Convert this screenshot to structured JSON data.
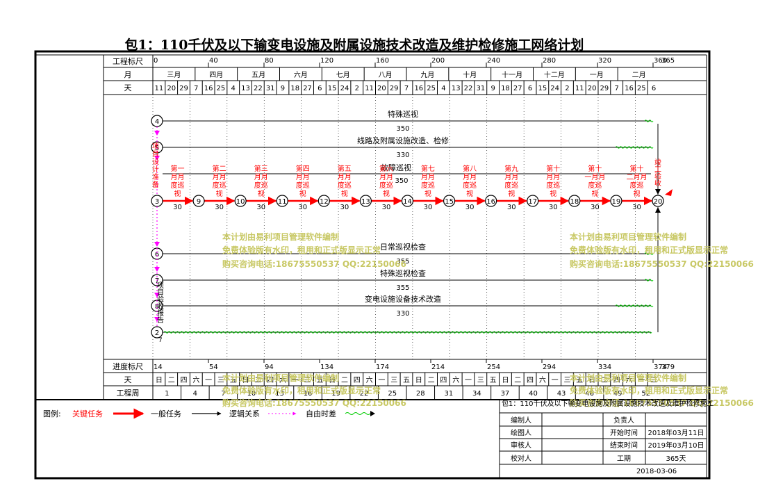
{
  "title": "包1：110千伏及以下输变电设施及附属设施技术改造及维护检修施工网络计划",
  "header_rows": {
    "scale_label": "工程标尺",
    "month_label": "月",
    "day_label": "天",
    "progress_label": "进度标尺",
    "weekday_row_label": "天",
    "week_label": "工程周"
  },
  "top_scale": {
    "ticks": [
      "0",
      "40",
      "80",
      "120",
      "160",
      "200",
      "240",
      "280",
      "320",
      "360"
    ],
    "end": "365"
  },
  "months": [
    "三月",
    "四月",
    "五月",
    "六月",
    "七月",
    "八月",
    "九月",
    "十月",
    "十一月",
    "十二月",
    "一月",
    "二月"
  ],
  "days": [
    "11",
    "20",
    "29",
    "7",
    "16",
    "25",
    "4",
    "13",
    "22",
    "31",
    "9",
    "18",
    "27",
    "6",
    "15",
    "24",
    "2",
    "11",
    "20",
    "29",
    "7",
    "16",
    "25",
    "4",
    "13",
    "22",
    "31",
    "9",
    "18",
    "27",
    "6",
    "15",
    "24",
    "2",
    "11",
    "20",
    "29",
    "7",
    "16",
    "25",
    "6"
  ],
  "progress_scale": {
    "ticks": [
      "14",
      "54",
      "94",
      "134",
      "174",
      "214",
      "254",
      "294",
      "334",
      "374"
    ],
    "end": "379"
  },
  "weekdays": [
    "日",
    "二",
    "四",
    "六",
    "一",
    "三",
    "五",
    "日",
    "二",
    "四",
    "六",
    "一",
    "三",
    "五",
    "日",
    "二",
    "四",
    "六",
    "一",
    "三",
    "五",
    "日",
    "二",
    "四",
    "六",
    "一",
    "三",
    "五",
    "日",
    "二",
    "四",
    "六",
    "一",
    "三",
    "五",
    "日",
    "二",
    "四",
    "六",
    "一",
    "三"
  ],
  "weeks": [
    "1",
    "4",
    "7",
    "10",
    "13",
    "16",
    "19",
    "22",
    "25",
    "28",
    "31",
    "34",
    "37",
    "40",
    "43",
    "46",
    "49",
    "52"
  ],
  "chart_data": {
    "type": "network-plan",
    "total_days": "365",
    "tasks": [
      {
        "name": "特殊巡视",
        "duration": "350",
        "from": "4",
        "critical": false
      },
      {
        "name": "线路及附属设施改造、检修",
        "duration": "330",
        "from": "5",
        "critical": false
      },
      {
        "name": "故障巡视",
        "duration": "350",
        "critical": false
      },
      {
        "name": "日常巡视检查",
        "duration": "355",
        "from": "6",
        "critical": false
      },
      {
        "name": "特殊巡视检查",
        "duration": "355",
        "from": "7",
        "critical": false
      },
      {
        "name": "变电设施设备技术改造",
        "duration": "330",
        "from": "8",
        "critical": false
      },
      {
        "name": "7",
        "from": "2",
        "critical": false
      }
    ],
    "critical_path": [
      {
        "name": "第一月月度巡视",
        "duration": "30"
      },
      {
        "name": "第二月月度巡视",
        "duration": "30"
      },
      {
        "name": "第三月月度巡视",
        "duration": "30"
      },
      {
        "name": "第四月月度巡视",
        "duration": "30"
      },
      {
        "name": "第五月月度巡视",
        "duration": "30"
      },
      {
        "name": "第六月月度巡视",
        "duration": "30"
      },
      {
        "name": "第七月月度巡视",
        "duration": "30"
      },
      {
        "name": "第八月月度巡视",
        "duration": "30"
      },
      {
        "name": "第九月月度巡视",
        "duration": "30"
      },
      {
        "name": "第十月月度巡视",
        "duration": "30"
      },
      {
        "name": "第十一月月度巡视",
        "duration": "30"
      },
      {
        "name": "第十二月月度巡视",
        "duration": "30"
      }
    ],
    "critical_nodes": [
      "3",
      "9",
      "10",
      "11",
      "12",
      "13",
      "14",
      "15",
      "16",
      "17",
      "18",
      "19",
      "20"
    ],
    "left_nodes": [
      "4",
      "5",
      "3",
      "6",
      "7",
      "8",
      "2"
    ],
    "vertical_labels": [
      "项目设计准备",
      "项目验收报告",
      "竣工验收"
    ]
  },
  "legend": {
    "title": "图例:",
    "critical": "关键任务",
    "normal": "一般任务",
    "logic": "逻辑关系",
    "float": "自由时差"
  },
  "info": {
    "project": "包1：110千伏及以下输变电设施及附属设施技术改造及维护检修施工",
    "rows": [
      {
        "label": "编制人",
        "value": "",
        "label2": "负责人",
        "value2": ""
      },
      {
        "label": "绘图人",
        "value": "",
        "label2": "开始时间",
        "value2": "2018年03月11日"
      },
      {
        "label": "审核人",
        "value": "",
        "label2": "结束时间",
        "value2": "2019年03月10日"
      },
      {
        "label": "校对人",
        "value": "",
        "label2": "工期",
        "value2": "365天"
      }
    ],
    "date": "2018-03-06"
  },
  "watermark": {
    "line1": "本计划由易利项目管理软件编制",
    "line2": "免费体验版有水印，租用和正式版显示正常",
    "line3": "购买咨询电话:18675550537 QQ:22150066"
  },
  "colors": {
    "critical": "#ff0000",
    "logic": "#ff00ff",
    "float": "#00cc00",
    "watermark": "#c8c864"
  }
}
